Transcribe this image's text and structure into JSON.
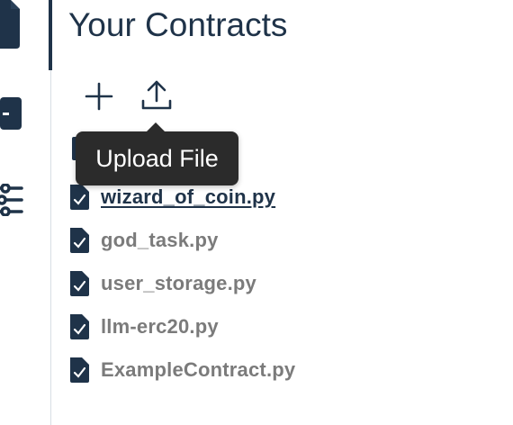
{
  "panel": {
    "title": "Your Contracts"
  },
  "toolbar": {
    "add_icon": "plus-icon",
    "upload_icon": "upload-icon"
  },
  "tooltip": {
    "text": "Upload File"
  },
  "rail": {
    "items": [
      {
        "icon": "file-icon"
      },
      {
        "icon": "deploy-icon"
      },
      {
        "icon": "sliders-icon"
      }
    ]
  },
  "files": [
    {
      "name": "wizard_of_coin.py",
      "active": true
    },
    {
      "name": "god_task.py",
      "active": false
    },
    {
      "name": "user_storage.py",
      "active": false
    },
    {
      "name": "llm-erc20.py",
      "active": false
    },
    {
      "name": "ExampleContract.py",
      "active": false
    }
  ],
  "colors": {
    "primary": "#1f3349",
    "muted_text": "#7b7b7b",
    "tooltip_bg": "#2b2b2b",
    "divider": "#d8dee4"
  }
}
